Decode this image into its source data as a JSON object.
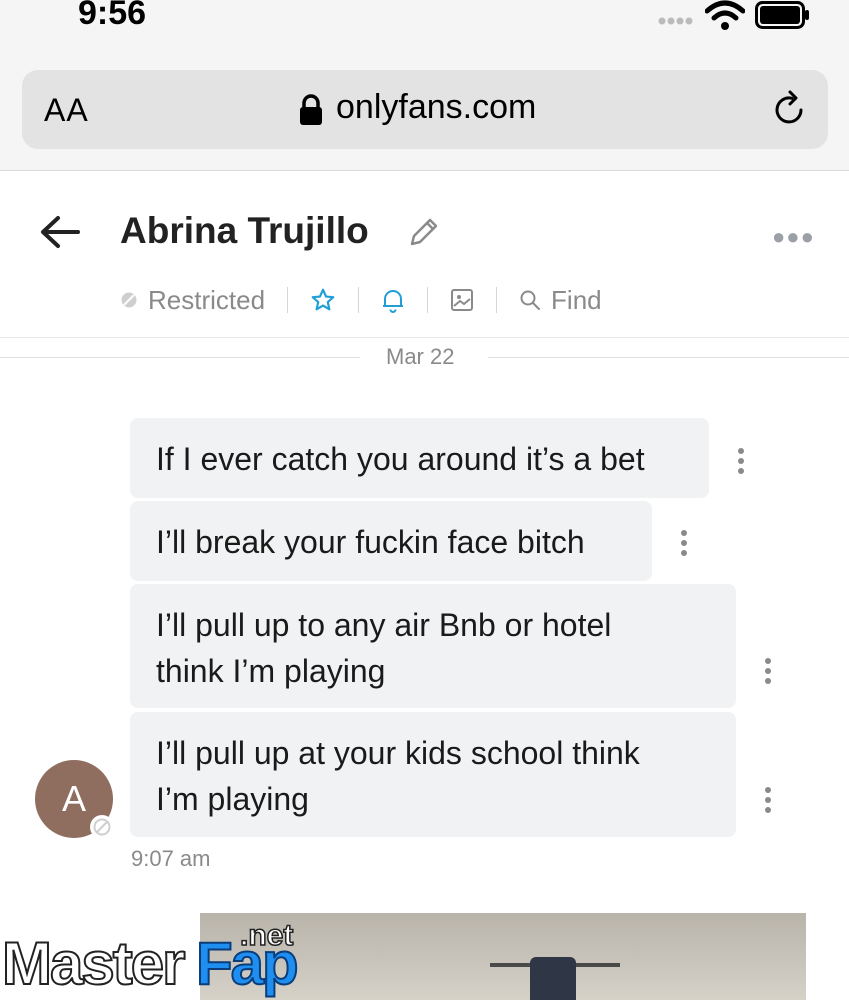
{
  "status_bar": {
    "time": "9:56"
  },
  "browser": {
    "text_size_label": "AA",
    "url": "onlyfans.com"
  },
  "chat": {
    "name": "Abrina Trujillo",
    "toolbar": {
      "restricted_label": "Restricted",
      "find_label": "Find"
    },
    "date_divider": "Mar 22",
    "avatar_initial": "A",
    "messages": [
      {
        "line1": "If I ever catch you around it’s a bet",
        "line2": ""
      },
      {
        "line1": "I’ll break your fuckin face bitch",
        "line2": ""
      },
      {
        "line1": "I’ll pull up to any air Bnb or hotel",
        "line2": "think I’m playing"
      },
      {
        "line1": "I’ll pull up at your kids school think",
        "line2": "I’m playing"
      }
    ],
    "timestamp": "9:07 am"
  },
  "watermark": {
    "part1": "Master",
    "part2": "Fap",
    "part3": ".net"
  },
  "colors": {
    "accent": "#1f9fd6",
    "bubble": "#f0f2f3",
    "muted": "#8a8a8a"
  }
}
